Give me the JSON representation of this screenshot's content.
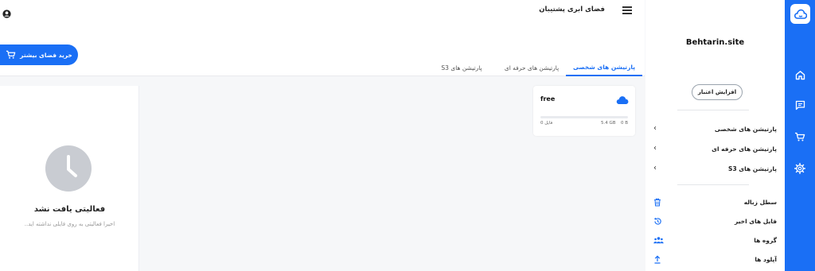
{
  "header": {
    "title": "فضای ابری پشتیبان",
    "buy_button": "خرید فضای بیشتر"
  },
  "sidebar": {
    "site_name": "Behtarin.site",
    "credit_button": "افزایش اعتبار",
    "partitions": [
      {
        "label": "پارتیشن های شخصی"
      },
      {
        "label": "پارتیشن های حرفه ای"
      },
      {
        "label": "پارتیشن های S3"
      }
    ],
    "links": [
      {
        "label": "سطل زباله",
        "icon": "trash-icon"
      },
      {
        "label": "فایل های اخیر",
        "icon": "history-icon"
      },
      {
        "label": "گروه ها",
        "icon": "group-icon"
      },
      {
        "label": "آپلود ها",
        "icon": "upload-icon"
      }
    ]
  },
  "rail": {
    "icons": [
      "home-icon",
      "chat-icon",
      "cart-icon",
      "gear-icon"
    ],
    "color": "#1a6ff5"
  },
  "tabs": [
    {
      "label": "پارتیشن های شخصی",
      "active": true
    },
    {
      "label": "پارتیشن های حرفه ای",
      "active": false
    },
    {
      "label": "پارتیشن های S3",
      "active": false
    }
  ],
  "card": {
    "name": "free",
    "used": "0 B",
    "total": "5.4 GB",
    "files": "0 فایل",
    "usage_fraction": 0
  },
  "activity": {
    "empty_title": "فعالیتی یافت نشد",
    "empty_subtitle": "اخیرا فعالیتی به روی فایلی نداشته اید.."
  }
}
